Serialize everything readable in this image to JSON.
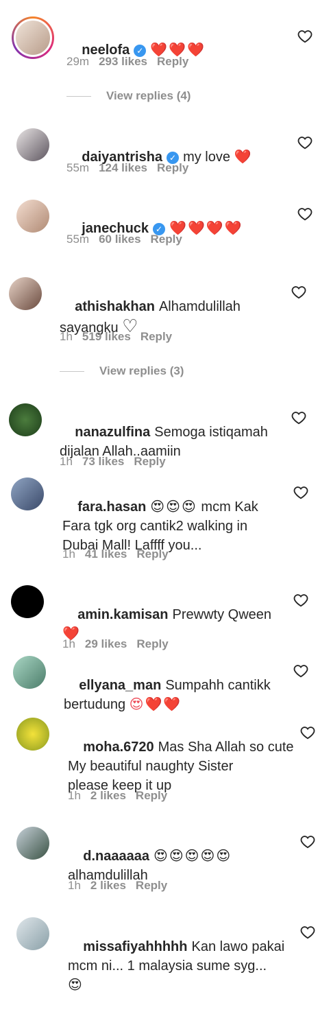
{
  "comments": [
    {
      "username": "neelofa",
      "verified": true,
      "text": "",
      "emoji": "❤️❤️❤️",
      "time": "29m",
      "likes": "293 likes",
      "reply": "Reply"
    },
    {
      "username": "daiyantrisha",
      "verified": true,
      "text": "my love ",
      "emoji": "❤️",
      "time": "55m",
      "likes": "124 likes",
      "reply": "Reply"
    },
    {
      "username": "janechuck",
      "verified": true,
      "text": "",
      "emoji": "❤️❤️❤️❤️",
      "time": "55m",
      "likes": "60 likes",
      "reply": "Reply"
    },
    {
      "username": "athishakhan",
      "verified": false,
      "text": "Alhamdulillah\nsayangku ",
      "emoji": "♡",
      "time": "1h",
      "likes": "519 likes",
      "reply": "Reply"
    },
    {
      "username": "nanazulfina",
      "verified": false,
      "text": "Semoga istiqamah\ndijalan Allah..aamiin",
      "emoji": "",
      "time": "1h",
      "likes": "73 likes",
      "reply": "Reply"
    },
    {
      "username": "fara.hasan",
      "verified": false,
      "text": " mcm Kak\nFara tgk org cantik2 walking in\nDubai Mall! Laffff you...",
      "emoji": "😍😍😍",
      "time": "1h",
      "likes": "41 likes",
      "reply": "Reply"
    },
    {
      "username": "amin.kamisan",
      "verified": false,
      "text": "Prewwty Qween\n",
      "emoji": "❤️",
      "time": "1h",
      "likes": "29 likes",
      "reply": "Reply"
    },
    {
      "username": "ellyana_man",
      "verified": false,
      "text": "Sumpahh cantikk\nbertudung ",
      "emoji": "😍❤️❤️",
      "time": "",
      "likes": "",
      "reply": ""
    },
    {
      "username": "moha.6720",
      "verified": false,
      "text": "Mas Sha Allah so cute\nMy beautiful naughty Sister\nplease keep it up",
      "emoji": "",
      "time": "1h",
      "likes": "2 likes",
      "reply": "Reply"
    },
    {
      "username": "d.naaaaaa",
      "verified": false,
      "text": "",
      "emoji": "😍😍😍😍😍",
      "text2": "alhamdulillah",
      "time": "1h",
      "likes": "2 likes",
      "reply": "Reply"
    },
    {
      "username": "missafiyahhhhh",
      "verified": false,
      "text": "Kan lawo pakai\nmcm ni... 1 malaysia sume syg...\n",
      "emoji": "😍",
      "time": "",
      "likes": "",
      "reply": ""
    }
  ],
  "view_replies": [
    "View replies (4)",
    "View replies (3)"
  ],
  "icons": {
    "like": "heart-outline-icon",
    "verified": "verified-badge-icon"
  }
}
